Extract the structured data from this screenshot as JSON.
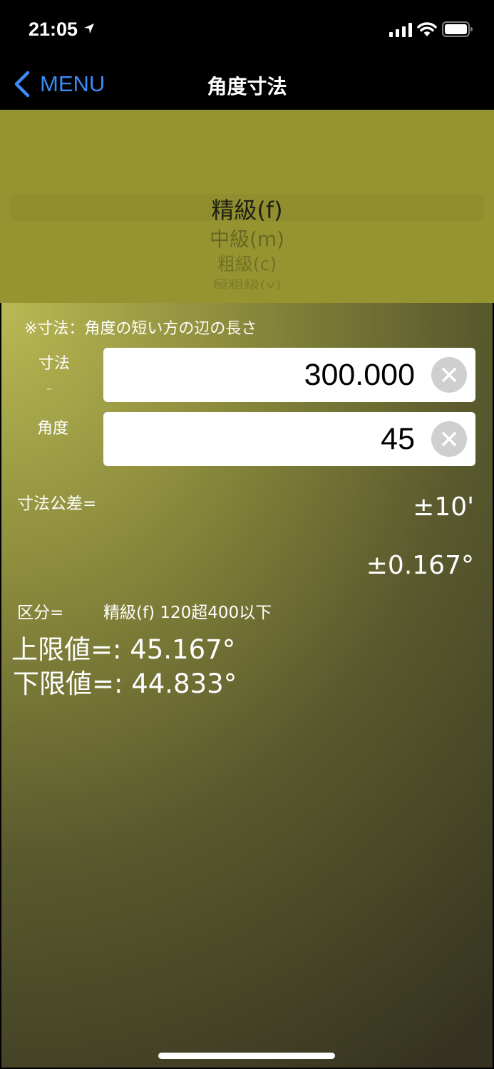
{
  "status_bar": {
    "time": "21:05"
  },
  "nav": {
    "back_label": "MENU",
    "title": "角度寸法"
  },
  "picker": {
    "options": [
      "精級(f)",
      "中級(m)",
      "粗級(c)",
      "極粗級(v)"
    ],
    "selected": "精級(f)"
  },
  "form": {
    "note": "※寸法：角度の短い方の辺の長さ",
    "dimension_label": "寸法",
    "dimension_value": "300.000",
    "angle_label": "角度",
    "angle_value": "45"
  },
  "results": {
    "tolerance_label": "寸法公差=",
    "tolerance_minutes": "±10'",
    "tolerance_degrees": "±0.167°",
    "category_label": "区分=",
    "category_value": "精級(f) 120超400以下",
    "upper_limit": "上限値=: 45.167°",
    "lower_limit": "下限値=: 44.833°"
  },
  "colors": {
    "accent": "#3b8cf5",
    "picker_bg": "#969431",
    "content_top": "#b9b954",
    "content_bottom": "#353320"
  }
}
